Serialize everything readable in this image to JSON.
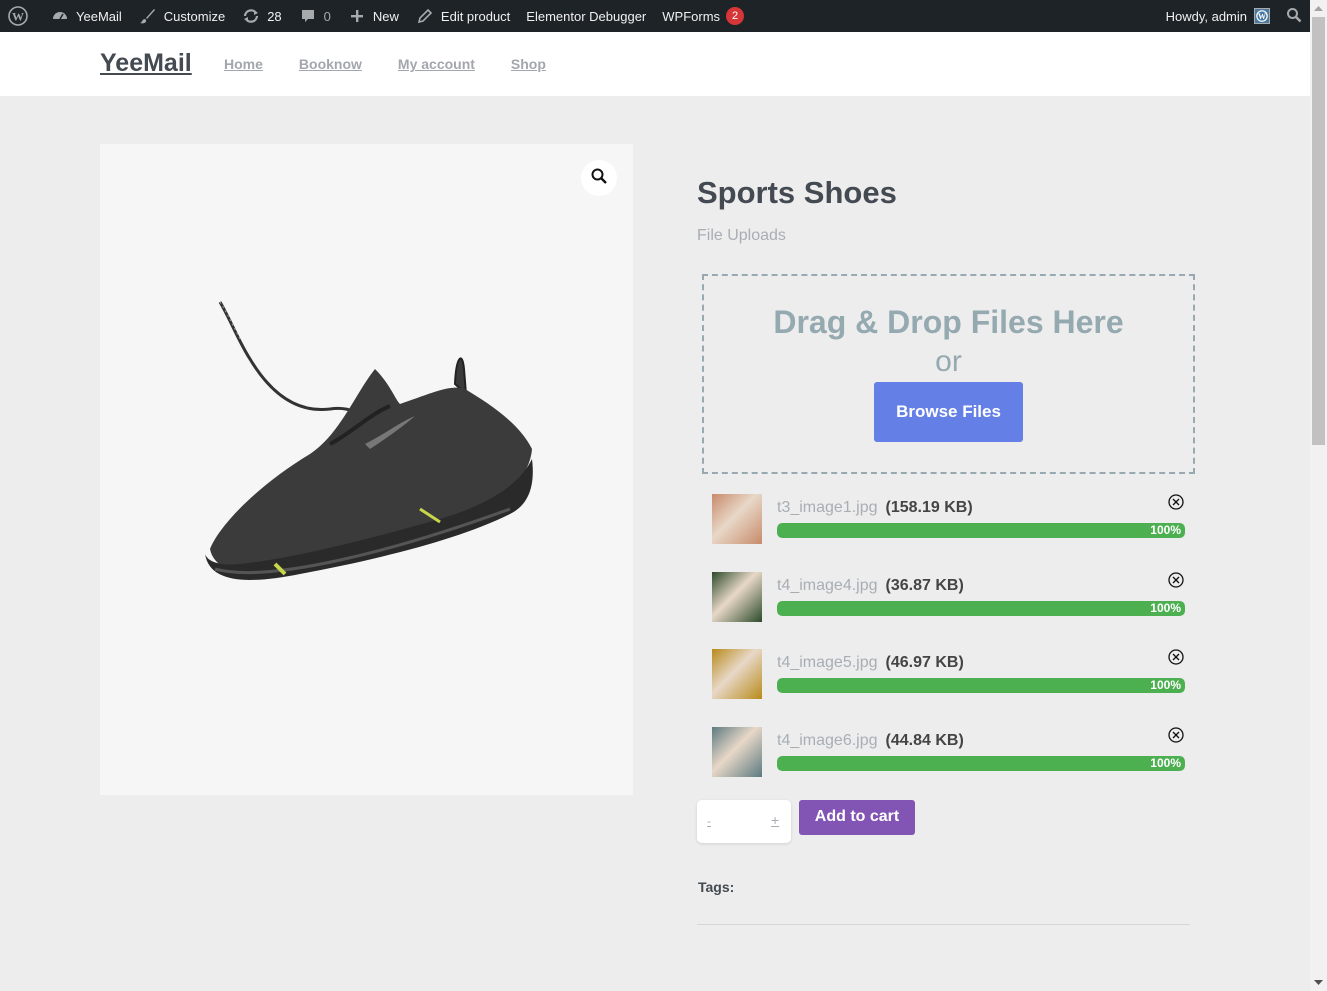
{
  "admin_bar": {
    "wp_logo": "wordpress-icon",
    "site_name": "YeeMail",
    "customize": "Customize",
    "updates_count": "28",
    "comments_count": "0",
    "new": "New",
    "edit_product": "Edit product",
    "elementor_debugger": "Elementor Debugger",
    "wpforms": "WPForms",
    "wpforms_badge": "2",
    "howdy": "Howdy, admin"
  },
  "header": {
    "site_title": "YeeMail",
    "nav": [
      {
        "label": "Home"
      },
      {
        "label": "Booknow"
      },
      {
        "label": "My account"
      },
      {
        "label": "Shop"
      }
    ]
  },
  "product": {
    "title": "Sports Shoes",
    "uploads_label": "File Uploads",
    "image_alt": "Black sports shoe",
    "dropzone": {
      "title": "Drag & Drop Files Here",
      "or": "or",
      "browse": "Browse Files"
    },
    "files": [
      {
        "name": "t3_image1.jpg",
        "size": "(158.19 KB)",
        "progress": 100,
        "progress_label": "100%",
        "thumb_color": "#c78a6a"
      },
      {
        "name": "t4_image4.jpg",
        "size": "(36.87 KB)",
        "progress": 100,
        "progress_label": "100%",
        "thumb_color": "#2c4a2a"
      },
      {
        "name": "t4_image5.jpg",
        "size": "(46.97 KB)",
        "progress": 100,
        "progress_label": "100%",
        "thumb_color": "#b88a1a"
      },
      {
        "name": "t4_image6.jpg",
        "size": "(44.84 KB)",
        "progress": 100,
        "progress_label": "100%",
        "thumb_color": "#5c7a80"
      }
    ],
    "qty_minus": "-",
    "qty_plus": "+",
    "qty_value": "",
    "add_to_cart": "Add to cart",
    "tags_label": "Tags:"
  },
  "colors": {
    "admin_bar": "#1d2327",
    "browse_button": "#647fe5",
    "progress": "#4caf50",
    "add_to_cart": "#8254b4",
    "badge": "#d63638"
  }
}
